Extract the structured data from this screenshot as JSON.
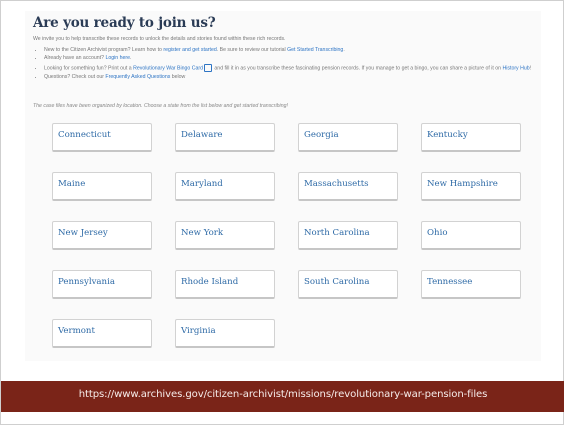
{
  "heading": "Are you ready to join us?",
  "intro": "We invite you to help transcribe these records to unlock the details and stories found within these rich records.",
  "bullets": [
    {
      "before": "New to the Citizen Archivist program? Learn how to ",
      "link1": "register and get started",
      "middle": ". Be sure to review our tutorial ",
      "link2": "Get Started Transcribing",
      "after": "."
    },
    {
      "before": "Already have an account? ",
      "link1": "Login here",
      "after": "."
    },
    {
      "before": "Looking for something fun? Print out a ",
      "link1": "Revolutionary War Bingo Card",
      "middle": " and fill it in as you transcribe these fascinating pension records. If you manage to get a bingo, you can share a picture of it on ",
      "link2": "History Hub",
      "after": "!"
    },
    {
      "before": "Questions? Check out our ",
      "link1": "Frequently Asked Questions",
      "after": " below"
    }
  ],
  "org_note": "The case files have been organized by location. Choose a state from the list below and get started transcribing!",
  "states": [
    "Connecticut",
    "Delaware",
    "Georgia",
    "Kentucky",
    "Maine",
    "Maryland",
    "Massachusetts",
    "New Hampshire",
    "New Jersey",
    "New York",
    "North Carolina",
    "Ohio",
    "Pennsylvania",
    "Rhode Island",
    "South Carolina",
    "Tennessee",
    "Vermont",
    "Virginia"
  ],
  "url": "https://www.archives.gov/citizen-archivist/missions/revolutionary-war-pension-files",
  "colors": {
    "heading": "#2a3b55",
    "link": "#2d74c4",
    "state_text": "#2e6aa6",
    "url_bar": "#7a2418",
    "url_text": "#f6ecea"
  }
}
